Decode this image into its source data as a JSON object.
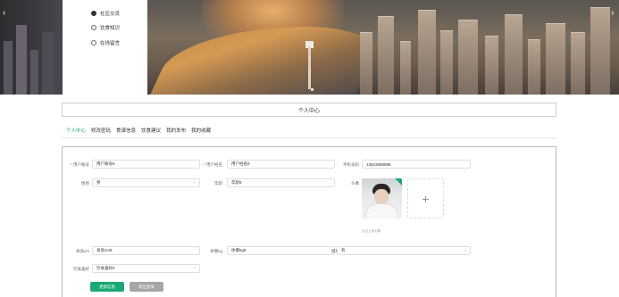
{
  "banner": {
    "prev_arrow": "‹",
    "next_arrow": "›",
    "menu": [
      {
        "label": "社区交流",
        "icon": "user-icon"
      },
      {
        "label": "饮食知识",
        "icon": "book-icon"
      },
      {
        "label": "在线留言",
        "icon": "message-icon"
      }
    ]
  },
  "page_title": "个人中心",
  "tabs": [
    {
      "label": "个人中心",
      "active": true
    },
    {
      "label": "修改密码",
      "active": false
    },
    {
      "label": "食谱信息",
      "active": false
    },
    {
      "label": "饮食建议",
      "active": false
    },
    {
      "label": "我的发布",
      "active": false
    },
    {
      "label": "我的收藏",
      "active": false
    }
  ],
  "form": {
    "account_label": "用户账号",
    "account_value": "用户账号8",
    "name_label": "用户姓名",
    "name_value": "用户姓名8",
    "phone_label": "手机号码",
    "phone_value": "13823888888",
    "gender_label": "性别",
    "gender_value": "男",
    "age_label": "年龄",
    "age_value": "年龄8",
    "avatar_label": "头像",
    "upload_plus": "+",
    "upload_tip": "点击上传头像",
    "height_label": "身高cm",
    "height_value": "身高cm8",
    "weight_label": "体重kg",
    "weight_value": "体重kg8",
    "health_label": "健康情况",
    "health_value": "有",
    "diet_label": "饮食喜好",
    "diet_value": "饮食喜好8"
  },
  "buttons": {
    "update_label": "更新信息",
    "logout_label": "退出登录"
  },
  "colors": {
    "accent": "#19a974",
    "secondary_button": "#a6a6a6"
  }
}
